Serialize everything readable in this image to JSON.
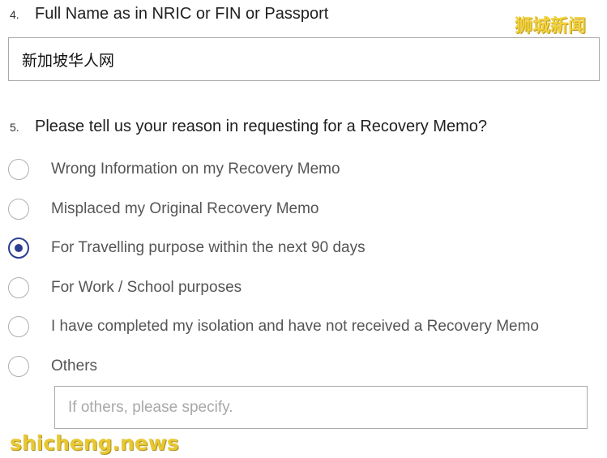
{
  "q4": {
    "number": "4.",
    "question": "Full Name as in NRIC or FIN or Passport",
    "value": "新加坡华人网"
  },
  "q5": {
    "number": "5.",
    "question": "Please tell us your reason in requesting for a Recovery Memo?",
    "options": [
      {
        "label": "Wrong Information on my Recovery Memo",
        "selected": false
      },
      {
        "label": "Misplaced my Original Recovery Memo",
        "selected": false
      },
      {
        "label": "For Travelling purpose within the next 90 days",
        "selected": true
      },
      {
        "label": "For Work / School purposes",
        "selected": false
      },
      {
        "label": "I have completed my isolation and have not received a Recovery Memo",
        "selected": false
      },
      {
        "label": "Others",
        "selected": false
      }
    ],
    "others_placeholder": "If others, please specify."
  },
  "watermarks": {
    "top": "狮城新闻",
    "bottom": "shicheng.news"
  },
  "colors": {
    "radio_selected": "#2c3e8f",
    "watermark": "#f2d23c"
  }
}
